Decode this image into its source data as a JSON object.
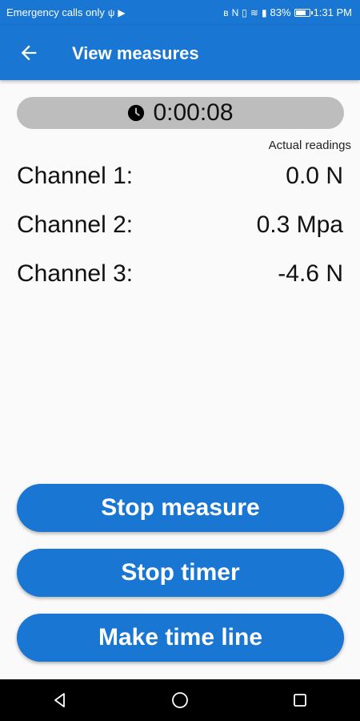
{
  "status_bar": {
    "carrier": "Emergency calls only",
    "battery": "83%",
    "battery_level": 0.83,
    "time": "1:31 PM",
    "icons": [
      "usb-icon",
      "cast-icon",
      "bluetooth-icon",
      "nfc-icon",
      "vibrate-icon",
      "wifi-icon",
      "sim-icon",
      "battery-icon"
    ]
  },
  "toolbar": {
    "title": "View measures",
    "back_icon": "arrow-left-icon"
  },
  "timer": {
    "icon": "clock-icon",
    "value": "0:00:08",
    "caption": "Actual readings"
  },
  "channels": [
    {
      "label": "Channel 1:",
      "value": "0.0 N"
    },
    {
      "label": "Channel 2:",
      "value": "0.3 Mpa"
    },
    {
      "label": "Channel 3:",
      "value": "-4.6 N"
    }
  ],
  "buttons": {
    "stop_measure": "Stop measure",
    "stop_timer": "Stop timer",
    "make_time_line": "Make time line"
  },
  "nav_bar": {
    "icons": [
      "back-triangle-icon",
      "home-circle-icon",
      "recents-square-icon"
    ]
  },
  "colors": {
    "primary": "#1976d2",
    "timer_bg": "#bdbdbd",
    "background": "#fafafa"
  }
}
